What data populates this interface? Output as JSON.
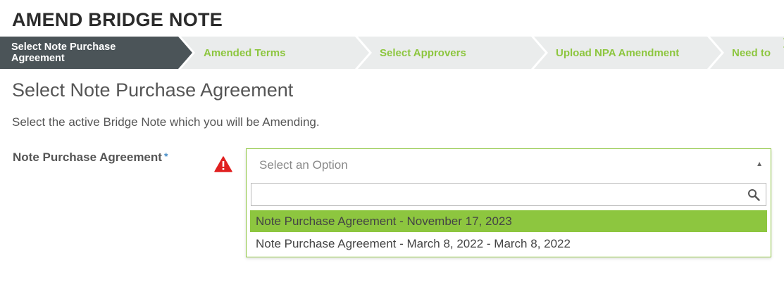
{
  "page": {
    "title": "AMEND BRIDGE NOTE"
  },
  "stepper": {
    "steps": [
      {
        "label": "Select Note Purchase Agreement",
        "state": "active"
      },
      {
        "label": "Amended Terms",
        "state": "pending"
      },
      {
        "label": "Select Approvers",
        "state": "pending"
      },
      {
        "label": "Upload NPA Amendment",
        "state": "pending"
      },
      {
        "label": "Need to",
        "state": "pending"
      }
    ],
    "next_icon": "chevron-right-icon",
    "active_color": "#4b5458",
    "pending_color": "#eaecec",
    "accent_color": "#8dc63f"
  },
  "section": {
    "title": "Select Note Purchase Agreement",
    "instructions": "Select the active Bridge Note which you will be Amending."
  },
  "form": {
    "field_label": "Note Purchase Agreement",
    "required_mark": "*",
    "warning_icon": "warning-triangle-icon",
    "warning_color": "#e02020",
    "select": {
      "placeholder": "Select an Option",
      "caret_icon": "caret-up-icon",
      "search_value": "",
      "search_icon": "search-icon",
      "options": [
        {
          "label": "Note Purchase Agreement - November 17, 2023",
          "highlighted": true
        },
        {
          "label": "Note Purchase Agreement - March 8, 2022 - March 8, 2022",
          "highlighted": false
        }
      ]
    }
  }
}
